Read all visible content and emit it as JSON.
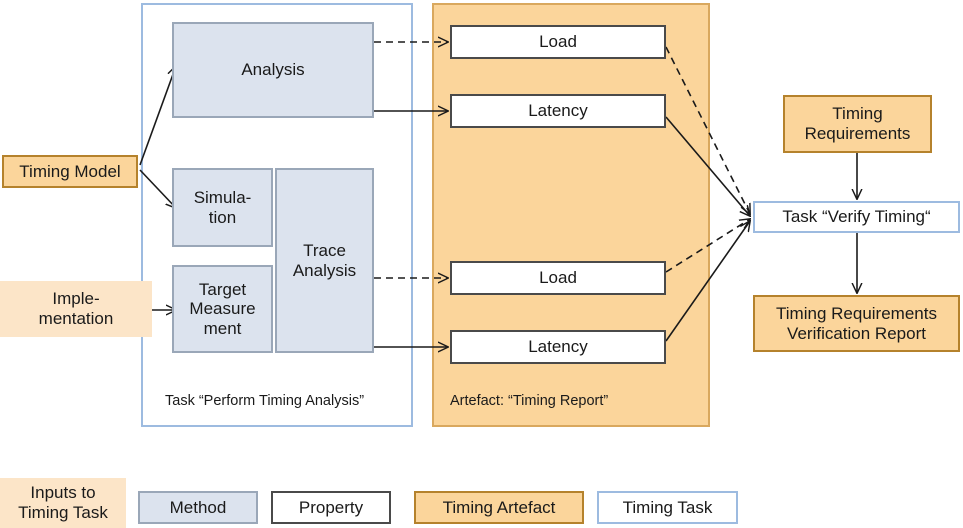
{
  "diagram": {
    "title_hidden": "",
    "containers": [
      {
        "id": "perform-timing-analysis",
        "label": "Task “Perform Timing Analysis”",
        "type": "timing-task"
      },
      {
        "id": "timing-report",
        "label": "Artefact: “Timing Report”",
        "type": "timing-artefact"
      }
    ],
    "inputs": [
      {
        "id": "timing-model",
        "label": "Timing Model",
        "style": "timing-artefact"
      },
      {
        "id": "implementation",
        "label": "Imple-\nmentation",
        "line1": "Imple-",
        "line2": "mentation",
        "style": "input-to-timing-task"
      }
    ],
    "methods": [
      {
        "id": "analysis",
        "label": "Analysis"
      },
      {
        "id": "simulation",
        "line1": "Simula-",
        "line2": "tion",
        "label": "Simulation"
      },
      {
        "id": "target-measurement",
        "line1": "Target",
        "line2": "Measure",
        "line3": "ment",
        "label": "Target Measurement"
      },
      {
        "id": "trace-analysis",
        "line1": "Trace",
        "line2": "Analysis",
        "label": "Trace Analysis"
      }
    ],
    "properties": [
      {
        "id": "load-top",
        "label": "Load"
      },
      {
        "id": "latency-top",
        "label": "Latency"
      },
      {
        "id": "load-bottom",
        "label": "Load"
      },
      {
        "id": "latency-bottom",
        "label": "Latency"
      }
    ],
    "right_column": [
      {
        "id": "timing-requirements",
        "line1": "Timing",
        "line2": "Requirements",
        "label": "Timing Requirements",
        "style": "timing-artefact"
      },
      {
        "id": "verify-timing",
        "label": "Task “Verify Timing“",
        "style": "timing-task"
      },
      {
        "id": "verification-report",
        "line1": "Timing Requirements",
        "line2": "Verification Report",
        "label": "Timing Requirements Verification Report",
        "style": "timing-artefact"
      }
    ],
    "legend": [
      {
        "id": "legend-inputs",
        "line1": "Inputs to",
        "line2": "Timing Task",
        "label": "Inputs to Timing Task",
        "style": "input-to-timing-task"
      },
      {
        "id": "legend-method",
        "label": "Method",
        "style": "method"
      },
      {
        "id": "legend-property",
        "label": "Property",
        "style": "property"
      },
      {
        "id": "legend-artefact",
        "label": "Timing Artefact",
        "style": "timing-artefact"
      },
      {
        "id": "legend-task",
        "label": "Timing Task",
        "style": "timing-task"
      }
    ],
    "colors": {
      "artefact_fill": "#fbd59b",
      "artefact_border": "#b5822c",
      "method_fill": "#dce3ee",
      "method_border": "#9aa7b8",
      "task_border": "#9dbbe0",
      "input_fill": "#fce5c8",
      "property_border": "#4a4a4a",
      "edge": "#1a1a1a"
    }
  }
}
